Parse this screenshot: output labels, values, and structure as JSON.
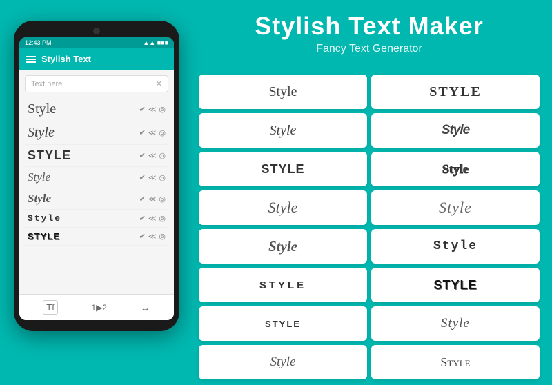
{
  "header": {
    "title": "Stylish Text Maker",
    "subtitle": "Fancy Text Generator"
  },
  "phone": {
    "status_bar": {
      "time": "12:43 PM",
      "signal": "▲▲▲",
      "battery": "■■■"
    },
    "toolbar_title": "Stylish Text",
    "search_placeholder": "Text here",
    "list_items": [
      {
        "text": "Style",
        "font_class": "font-serif"
      },
      {
        "text": "Style",
        "font_class": "font-italic-serif"
      },
      {
        "text": "STYLE",
        "font_class": "font-gothic"
      },
      {
        "text": "Style",
        "font_class": "font-script"
      },
      {
        "text": "Style",
        "font_class": "font-cursive"
      },
      {
        "text": "Style",
        "font_class": "font-mono"
      },
      {
        "text": "Style",
        "font_class": "font-block"
      }
    ]
  },
  "styles_grid": [
    {
      "text": "Style",
      "font_class": "font-serif"
    },
    {
      "text": "STYLE",
      "font_class": "font-bold-serif"
    },
    {
      "text": "Style",
      "font_class": "font-italic-serif"
    },
    {
      "text": "Style",
      "font_class": "font-condensed"
    },
    {
      "text": "STYLE",
      "font_class": "font-gothic"
    },
    {
      "text": "Style",
      "font_class": "font-outline"
    },
    {
      "text": "Style",
      "font_class": "font-script"
    },
    {
      "text": "Style",
      "font_class": "font-elegant"
    },
    {
      "text": "Style",
      "font_class": "font-cursive"
    },
    {
      "text": "Style",
      "font_class": "font-mono"
    },
    {
      "text": "STYLE",
      "font_class": "font-wide"
    },
    {
      "text": "STYLE",
      "font_class": "font-block"
    },
    {
      "text": "STYLE",
      "font_class": "font-wide"
    },
    {
      "text": "Style",
      "font_class": "font-handwrite"
    },
    {
      "text": "Style",
      "font_class": "font-script"
    },
    {
      "text": "Style",
      "font_class": "font-small-caps"
    }
  ],
  "bottom_icons": [
    "Tf",
    "1▶2",
    "↔"
  ]
}
